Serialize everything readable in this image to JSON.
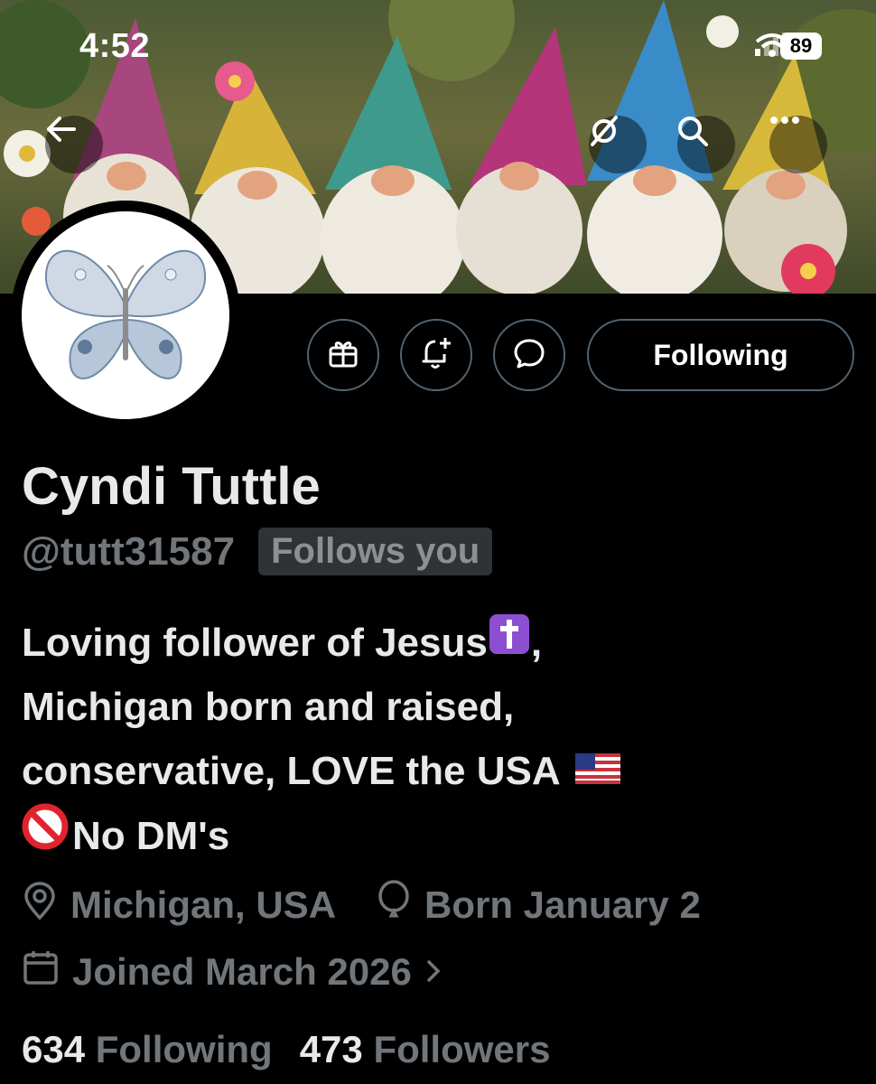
{
  "status_bar": {
    "time": "4:52",
    "battery": "89"
  },
  "profile": {
    "name": "Cyndi Tuttle",
    "handle": "@tutt31587",
    "follows_you_badge": "Follows you",
    "following_button_label": "Following",
    "bio": {
      "line1": "Loving follower of Jesus",
      "line1_end": ",",
      "line2": "Michigan born and raised,",
      "line3": "conservative, LOVE the USA",
      "line4": "No DM's"
    },
    "location": "Michigan, USA",
    "birthday": "Born January 2",
    "joined": "Joined March 2026",
    "following_count": "634",
    "following_label": "Following",
    "followers_count": "473",
    "followers_label": "Followers"
  },
  "colors": {
    "background": "#000000",
    "text": "#e7e9ea",
    "muted": "#71767b",
    "border": "#536471"
  },
  "icons": [
    "back-arrow-icon",
    "grok-icon",
    "search-icon",
    "more-icon",
    "gift-icon",
    "bell-plus-icon",
    "message-icon",
    "location-pin-icon",
    "balloon-icon",
    "calendar-icon",
    "chevron-right-icon",
    "cross-emoji",
    "us-flag-emoji",
    "no-entry-emoji"
  ]
}
